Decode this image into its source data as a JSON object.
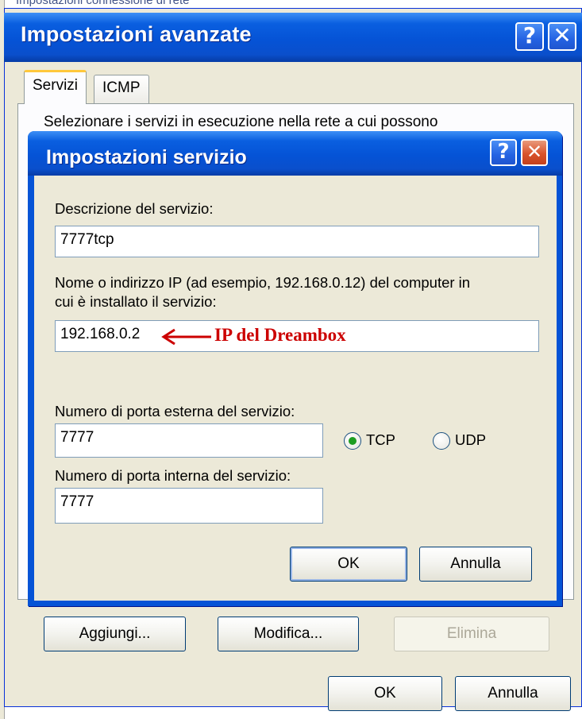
{
  "background_window": {
    "title_fragment": "Impostazioni connessione di rete"
  },
  "outer_dialog": {
    "title": "Impostazioni avanzate",
    "help_glyph": "?",
    "close_glyph": "✕",
    "tabs": [
      {
        "label": "Servizi",
        "active": true
      },
      {
        "label": "ICMP",
        "active": false
      }
    ],
    "panel_text": "Selezionare i servizi in esecuzione nella rete a cui possono",
    "buttons": {
      "add": "Aggiungi...",
      "edit": "Modifica...",
      "delete": "Elimina",
      "ok": "OK",
      "cancel": "Annulla"
    }
  },
  "inner_dialog": {
    "title": "Impostazioni servizio",
    "help_glyph": "?",
    "close_glyph": "✕",
    "description_label": "Descrizione del servizio:",
    "description_value": "7777tcp",
    "host_label_line1": "Nome o indirizzo IP (ad esempio, 192.168.0.12) del computer in",
    "host_label_line2": "cui è installato il servizio:",
    "host_value": "192.168.0.2",
    "external_port_label": "Numero di porta esterna del servizio:",
    "external_port_value": "7777",
    "internal_port_label": "Numero di porta interna del servizio:",
    "internal_port_value": "7777",
    "protocol_options": [
      {
        "label": "TCP",
        "selected": true
      },
      {
        "label": "UDP",
        "selected": false
      }
    ],
    "buttons": {
      "ok": "OK",
      "cancel": "Annulla"
    }
  },
  "annotation": {
    "text": "IP del Dreambox",
    "color": "#cc0000"
  },
  "colors": {
    "titlebar": "#0553d6",
    "dialog_face": "#ece9d8",
    "radio_selected": "#1d9d21"
  }
}
